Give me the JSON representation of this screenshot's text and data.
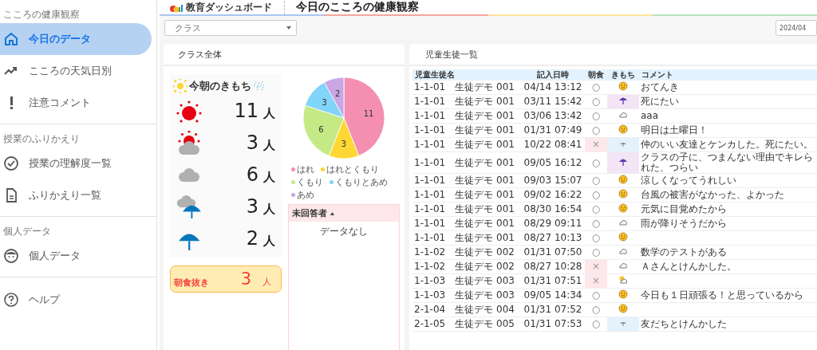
{
  "sidebar": {
    "sections": [
      {
        "label": "こころの健康観察",
        "items": [
          {
            "label": "今日のデータ",
            "selected": true
          },
          {
            "label": "こころの天気日別",
            "selected": false
          },
          {
            "label": "注意コメント",
            "selected": false
          }
        ]
      },
      {
        "label": "授業のふりかえり",
        "items": [
          {
            "label": "授業の理解度一覧",
            "selected": false
          },
          {
            "label": "ふりかえり一覧",
            "selected": false
          }
        ]
      },
      {
        "label": "個人データ",
        "items": [
          {
            "label": "個人データ",
            "selected": false
          }
        ]
      },
      {
        "items": [
          {
            "label": "ヘルプ",
            "selected": false
          }
        ]
      }
    ]
  },
  "header": {
    "logo_text": "教育ダッシュボード",
    "title": "今日のこころの健康観察"
  },
  "toolbar": {
    "class_select": {
      "placeholder": "クラス"
    },
    "date_field": {
      "value": "2024/04"
    }
  },
  "class_panel": {
    "title": "クラス全体",
    "mood_heading": "今朝のきもち",
    "moods": [
      {
        "kind": "sunny",
        "count": "11",
        "unit": "人"
      },
      {
        "kind": "sunny_cloudy",
        "count": "3",
        "unit": "人"
      },
      {
        "kind": "cloudy",
        "count": "6",
        "unit": "人"
      },
      {
        "kind": "cloudy_rain",
        "count": "3",
        "unit": "人"
      },
      {
        "kind": "rain",
        "count": "2",
        "unit": "人"
      }
    ],
    "breakfast_skip": {
      "label": "朝食抜き",
      "count": "3",
      "unit": "人"
    },
    "chart_data": {
      "type": "pie",
      "categories": [
        "はれ",
        "はれとくもり",
        "くもり",
        "くもりとあめ",
        "あめ"
      ],
      "values": [
        11,
        3,
        6,
        3,
        2
      ],
      "value_labels": [
        "11",
        "3",
        "6",
        "3",
        "2"
      ]
    },
    "legend": [
      {
        "color": "#f48fb1"
      },
      {
        "color": "#fdd835"
      },
      {
        "color": "#c5e985"
      },
      {
        "color": "#81d4fa"
      },
      {
        "color": "#c9a6e4"
      }
    ],
    "unanswered": {
      "title": "未回答者",
      "empty_text": "データなし"
    }
  },
  "student_panel": {
    "title": "児童生徒一覧",
    "columns": [
      "児童生徒名",
      "記入日時",
      "朝食",
      "きもち",
      "コメント"
    ],
    "rows": [
      {
        "student": "1-1-01　生徒デモ 001",
        "time": "04/14 13:12",
        "breakfast": "○",
        "skipped": false,
        "kind": "sunny",
        "comment": "おてんき"
      },
      {
        "student": "1-1-01　生徒デモ 001",
        "time": "03/11 15:42",
        "breakfast": "○",
        "skipped": false,
        "kind": "rain",
        "comment": "死にたい"
      },
      {
        "student": "1-1-01　生徒デモ 001",
        "time": "03/06 13:42",
        "breakfast": "○",
        "skipped": false,
        "kind": "cloudy",
        "comment": "aaa"
      },
      {
        "student": "1-1-01　生徒デモ 001",
        "time": "01/31 07:49",
        "breakfast": "○",
        "skipped": false,
        "kind": "sunny",
        "comment": "明日は土曜日！"
      },
      {
        "student": "1-1-01　生徒デモ 001",
        "time": "10/22 08:41",
        "breakfast": "×",
        "skipped": true,
        "kind": "cloudy_rain",
        "comment": "仲のいい友達とケンカした。死にたい。"
      },
      {
        "student": "1-1-01　生徒デモ 001",
        "time": "09/05 16:12",
        "breakfast": "○",
        "skipped": false,
        "kind": "rain",
        "comment": "クラスの子に、つまんない理由でキレられた、つらい"
      },
      {
        "student": "1-1-01　生徒デモ 001",
        "time": "09/03 15:07",
        "breakfast": "○",
        "skipped": false,
        "kind": "sunny",
        "comment": "涼しくなってうれしい"
      },
      {
        "student": "1-1-01　生徒デモ 001",
        "time": "09/02 16:22",
        "breakfast": "○",
        "skipped": false,
        "kind": "sunny",
        "comment": "台風の被害がなかった、よかった"
      },
      {
        "student": "1-1-01　生徒デモ 001",
        "time": "08/30 16:54",
        "breakfast": "○",
        "skipped": false,
        "kind": "sunny",
        "comment": "元気に目覚めたから"
      },
      {
        "student": "1-1-01　生徒デモ 001",
        "time": "08/29 09:11",
        "breakfast": "○",
        "skipped": false,
        "kind": "cloudy",
        "comment": "雨が降りそうだから"
      },
      {
        "student": "1-1-01　生徒デモ 001",
        "time": "08/27 10:13",
        "breakfast": "○",
        "skipped": false,
        "kind": "sunny"
      },
      {
        "student": "1-1-02　生徒デモ 002",
        "time": "01/31 07:50",
        "breakfast": "○",
        "skipped": false,
        "kind": "cloudy",
        "comment": "数学のテストがある"
      },
      {
        "student": "1-1-02　生徒デモ 002",
        "time": "08/27 10:28",
        "breakfast": "×",
        "skipped": true,
        "kind": "cloudy",
        "comment": "Ａさんとけんかした。"
      },
      {
        "student": "1-1-03　生徒デモ 003",
        "time": "01/31 07:51",
        "breakfast": "×",
        "skipped": true,
        "kind": "sunny_cloudy"
      },
      {
        "student": "1-1-03　生徒デモ 003",
        "time": "09/05 14:34",
        "breakfast": "○",
        "skipped": false,
        "kind": "sunny",
        "comment": "今日も１日頑張る！と思っているから"
      },
      {
        "student": "2-1-04　生徒デモ 004",
        "time": "01/31 07:52",
        "breakfast": "○",
        "skipped": false,
        "kind": "sunny"
      },
      {
        "student": "2-1-05　生徒デモ 005",
        "time": "01/31 07:53",
        "breakfast": "○",
        "skipped": false,
        "kind": "cloudy_rain",
        "comment": "友だちとけんかした"
      }
    ]
  }
}
